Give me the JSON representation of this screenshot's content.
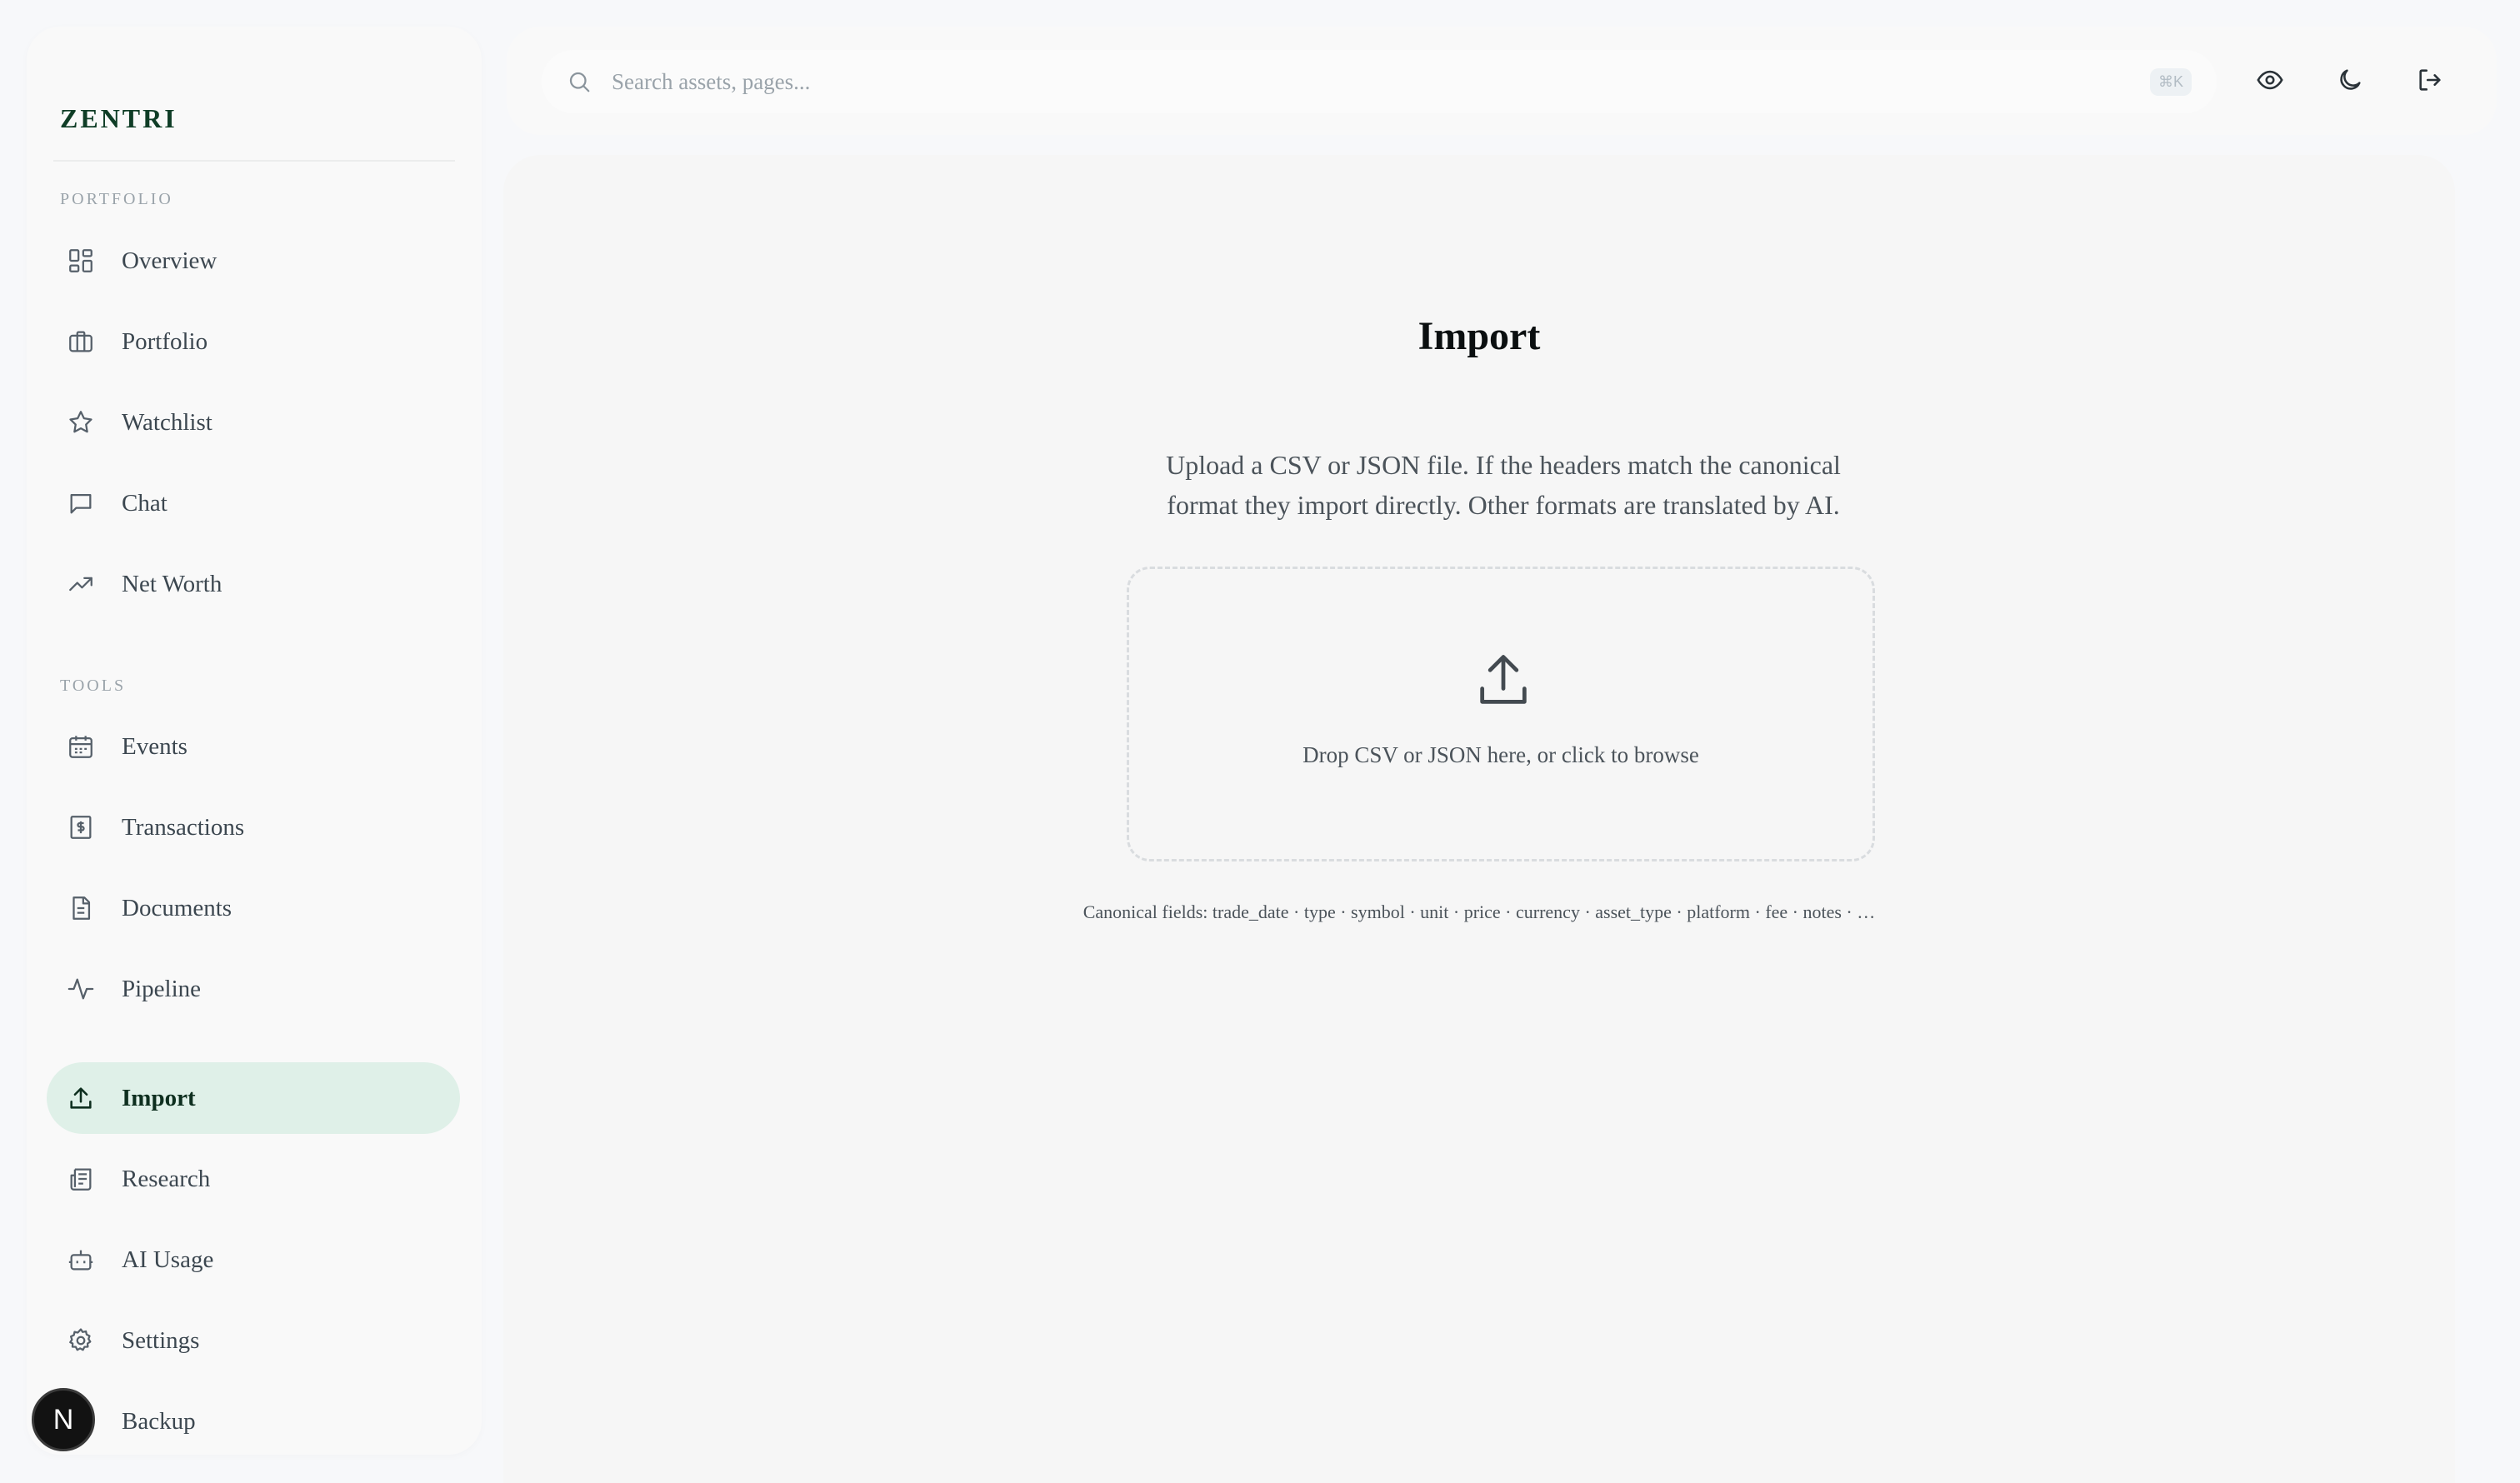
{
  "brand": "ZENTRI",
  "sidebar": {
    "portfolio_label": "PORTFOLIO",
    "tools_label": "TOOLS",
    "portfolio_items": [
      {
        "label": "Overview",
        "icon": "grid-icon"
      },
      {
        "label": "Portfolio",
        "icon": "briefcase-icon"
      },
      {
        "label": "Watchlist",
        "icon": "star-icon"
      },
      {
        "label": "Chat",
        "icon": "chat-icon"
      },
      {
        "label": "Net Worth",
        "icon": "trending-up-icon"
      }
    ],
    "tools_items": [
      {
        "label": "Events",
        "icon": "calendar-icon"
      },
      {
        "label": "Transactions",
        "icon": "receipt-icon"
      },
      {
        "label": "Documents",
        "icon": "document-icon"
      },
      {
        "label": "Pipeline",
        "icon": "activity-icon"
      },
      {
        "label": "Import",
        "icon": "upload-icon",
        "active": true
      },
      {
        "label": "Research",
        "icon": "newspaper-icon"
      },
      {
        "label": "AI Usage",
        "icon": "bot-icon"
      },
      {
        "label": "Settings",
        "icon": "gear-icon"
      },
      {
        "label": "Backup",
        "icon": "database-icon"
      }
    ]
  },
  "search": {
    "placeholder": "Search assets, pages...",
    "shortcut": "⌘K"
  },
  "topbar_icons": [
    "eye-icon",
    "moon-icon",
    "logout-icon"
  ],
  "main": {
    "title": "Import",
    "description": "Upload a CSV or JSON file. If the headers match the canonical format they import directly. Other formats are translated by AI.",
    "dropzone_text": "Drop CSV or JSON here, or click to browse",
    "canonical_fields": "Canonical fields: trade_date · type · symbol · unit · price · currency · asset_type · platform · fee · notes · …"
  },
  "avatar_initial": "N",
  "colors": {
    "accent": "#1f9a63",
    "active_bg": "#dff0e8",
    "brand": "#0f3d26"
  }
}
